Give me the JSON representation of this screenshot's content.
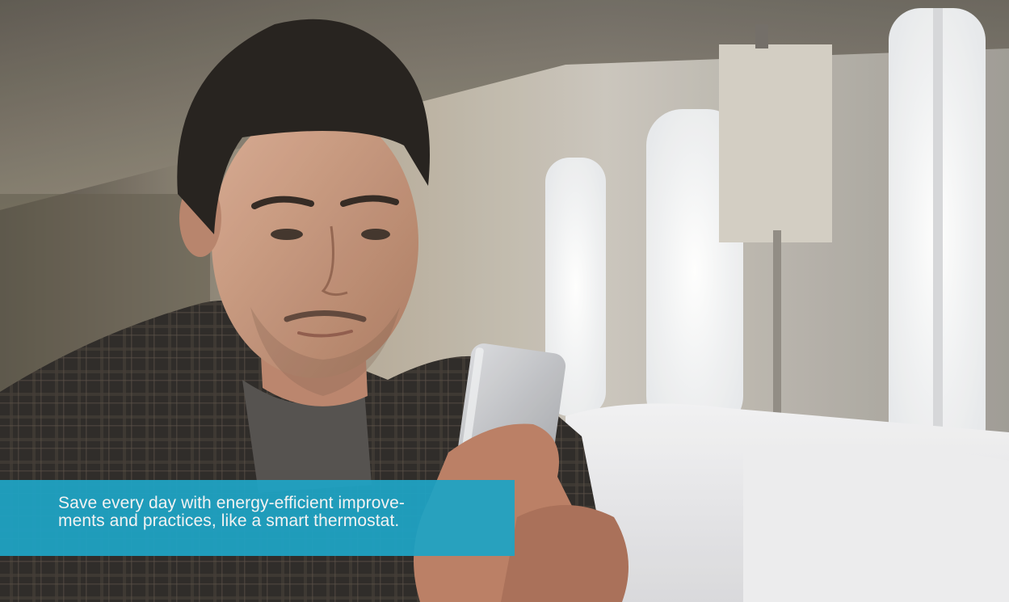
{
  "image": {
    "subject": "man-looking-at-smartphone-in-living-room"
  },
  "caption": {
    "line1": "Save every day with energy-efficient improve-",
    "line2": "ments and practices, like a smart thermostat."
  },
  "colors": {
    "caption_background": "#1fa3c4",
    "caption_text": "#ffffff"
  }
}
